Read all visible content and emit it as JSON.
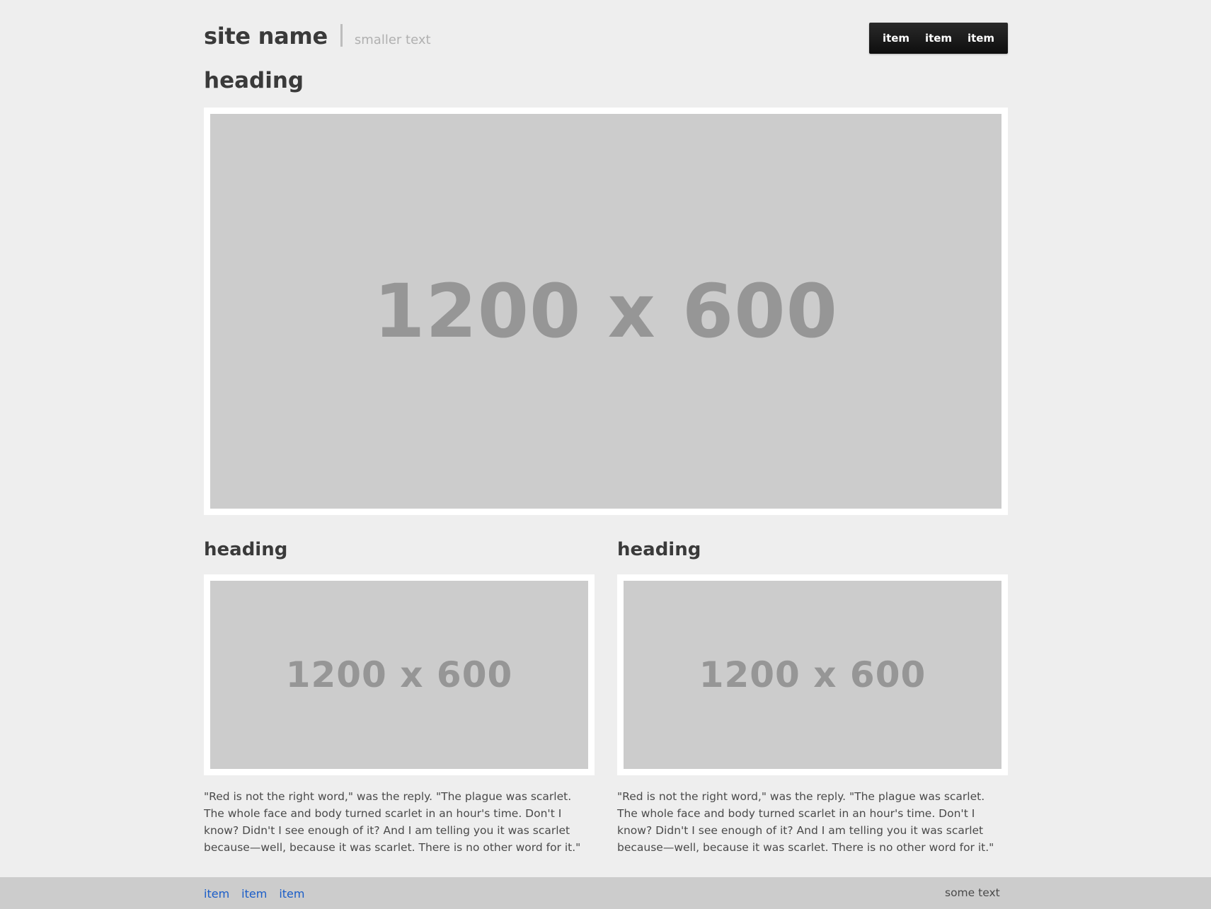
{
  "header": {
    "site_name": "site name",
    "tagline": "smaller text",
    "nav": [
      "item",
      "item",
      "item"
    ]
  },
  "main": {
    "heading": "heading",
    "hero_placeholder": "1200 x 600"
  },
  "columns": [
    {
      "heading": "heading",
      "placeholder": "1200 x 600",
      "text": "\"Red is not the right word,\" was the reply. \"The plague was scarlet. The whole face and body turned scarlet in an hour's time. Don't I know? Didn't I see enough of it? And I am telling you it was scarlet because—well, because it was scarlet. There is no other word for it.\""
    },
    {
      "heading": "heading",
      "placeholder": "1200 x 600",
      "text": "\"Red is not the right word,\" was the reply. \"The plague was scarlet. The whole face and body turned scarlet in an hour's time. Don't I know? Didn't I see enough of it? And I am telling you it was scarlet because—well, because it was scarlet. There is no other word for it.\""
    }
  ],
  "footer": {
    "links": [
      "item",
      "item",
      "item"
    ],
    "text": "some text"
  },
  "colors": {
    "background": "#eeeeee",
    "placeholder": "#cccccc",
    "placeholder_text": "#969696",
    "nav_bar": "#1a1a1a",
    "footer_bar": "#cccccc",
    "link": "#1a5dc8"
  }
}
